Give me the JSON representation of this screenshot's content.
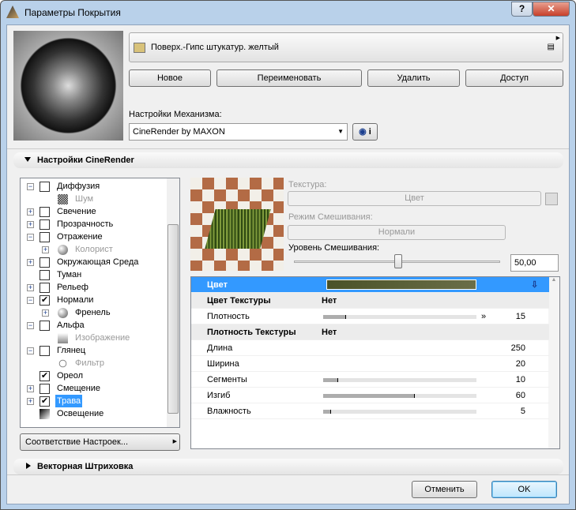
{
  "window": {
    "title": "Параметры Покрытия",
    "help": "?",
    "close": "✕"
  },
  "material": {
    "name": "Поверх.-Гипс штукатур. желтый",
    "swatch_color": "#d8c27a"
  },
  "buttons": {
    "new": "Новое",
    "rename": "Переименовать",
    "delete": "Удалить",
    "access": "Доступ",
    "cancel": "Отменить",
    "ok": "OK",
    "match": "Соответствие Настроек..."
  },
  "engine": {
    "label": "Настройки Механизма:",
    "value": "CineRender by MAXON",
    "info": "i"
  },
  "sections": {
    "cinerender": "Настройки CineRender",
    "vector": "Векторная Штриховка"
  },
  "tree": [
    {
      "label": "Диффузия",
      "level": 0,
      "expander": "minus",
      "checked": false,
      "icon": "checkbox"
    },
    {
      "label": "Шум",
      "level": 1,
      "disabled": true,
      "icon": "noise"
    },
    {
      "label": "Свечение",
      "level": 0,
      "expander": "plus",
      "checked": false,
      "icon": "checkbox"
    },
    {
      "label": "Прозрачность",
      "level": 0,
      "expander": "plus",
      "checked": false,
      "icon": "checkbox"
    },
    {
      "label": "Отражение",
      "level": 0,
      "expander": "minus",
      "checked": false,
      "icon": "checkbox"
    },
    {
      "label": "Колорист",
      "level": 1,
      "expander": "plus",
      "disabled": true,
      "icon": "sphere"
    },
    {
      "label": "Окружающая Среда",
      "level": 0,
      "expander": "plus",
      "checked": false,
      "icon": "checkbox"
    },
    {
      "label": "Туман",
      "level": 0,
      "checked": false,
      "icon": "checkbox"
    },
    {
      "label": "Рельеф",
      "level": 0,
      "expander": "plus",
      "checked": false,
      "icon": "checkbox"
    },
    {
      "label": "Нормали",
      "level": 0,
      "expander": "minus",
      "checked": true,
      "icon": "checkbox"
    },
    {
      "label": "Френель",
      "level": 1,
      "expander": "plus",
      "icon": "sphere"
    },
    {
      "label": "Альфа",
      "level": 0,
      "expander": "minus",
      "checked": false,
      "icon": "checkbox"
    },
    {
      "label": "Изображение",
      "level": 1,
      "disabled": true,
      "icon": "image"
    },
    {
      "label": "Глянец",
      "level": 0,
      "expander": "minus",
      "checked": false,
      "icon": "checkbox"
    },
    {
      "label": "Фильтр",
      "level": 1,
      "disabled": true,
      "icon": "filter"
    },
    {
      "label": "Ореол",
      "level": 0,
      "checked": true,
      "icon": "checkbox"
    },
    {
      "label": "Смещение",
      "level": 0,
      "expander": "plus",
      "checked": false,
      "icon": "checkbox"
    },
    {
      "label": "Трава",
      "level": 0,
      "expander": "plus",
      "checked": true,
      "selected": true,
      "icon": "checkbox"
    },
    {
      "label": "Освещение",
      "level": 0,
      "icon": "gradient"
    }
  ],
  "channel": {
    "texture_label": "Текстура:",
    "texture_value": "Цвет",
    "blend_mode_label": "Режим Смешивания:",
    "blend_mode_value": "Нормали",
    "blend_level_label": "Уровень Смешивания:",
    "blend_level_value": "50,00",
    "blend_level_fraction": 0.5
  },
  "props": [
    {
      "label": "Цвет",
      "type": "color",
      "selected": true,
      "color": "#4a5228"
    },
    {
      "label": "Цвет Текстуры",
      "value": "Нет",
      "type": "header"
    },
    {
      "label": "Плотность",
      "value": "15",
      "type": "slider",
      "fraction": 0.15,
      "arrow": true
    },
    {
      "label": "Плотность Текстуры",
      "value": "Нет",
      "type": "header"
    },
    {
      "label": "Длина",
      "value": "250",
      "type": "plain"
    },
    {
      "label": "Ширина",
      "value": "20",
      "type": "plain"
    },
    {
      "label": "Сегменты",
      "value": "10",
      "type": "slider",
      "fraction": 0.1
    },
    {
      "label": "Изгиб",
      "value": "60",
      "type": "slider",
      "fraction": 0.6
    },
    {
      "label": "Влажность",
      "value": "5",
      "type": "slider",
      "fraction": 0.05
    }
  ]
}
